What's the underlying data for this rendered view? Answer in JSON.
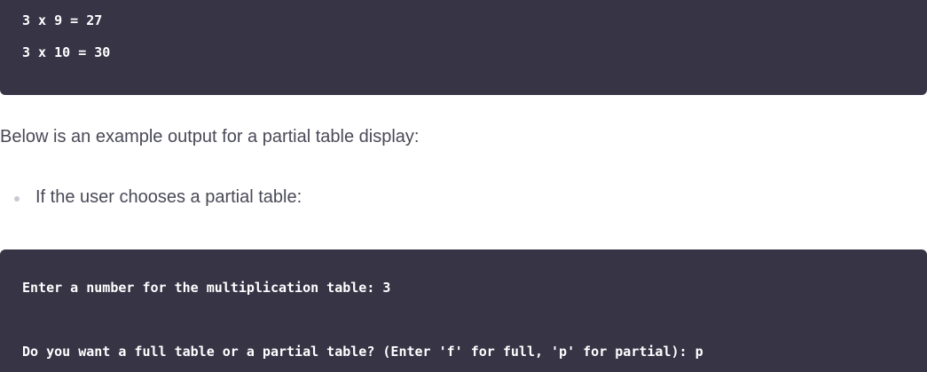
{
  "code_blocks": {
    "top": {
      "lines": [
        "3 x 9 = 27",
        "3 x 10 = 30"
      ]
    },
    "bottom": {
      "lines": [
        "Enter a number for the multiplication table: 3",
        "Do you want a full table or a partial table? (Enter 'f' for full, 'p' for partial): p"
      ]
    }
  },
  "content": {
    "paragraph": "Below is an example output for a partial table display:",
    "bullets": [
      "If the user chooses a partial table:"
    ]
  },
  "colors": {
    "code_background": "#373446",
    "code_text": "#ffffff",
    "body_text": "#4a4a58",
    "bullet": "#c9c9d1"
  }
}
